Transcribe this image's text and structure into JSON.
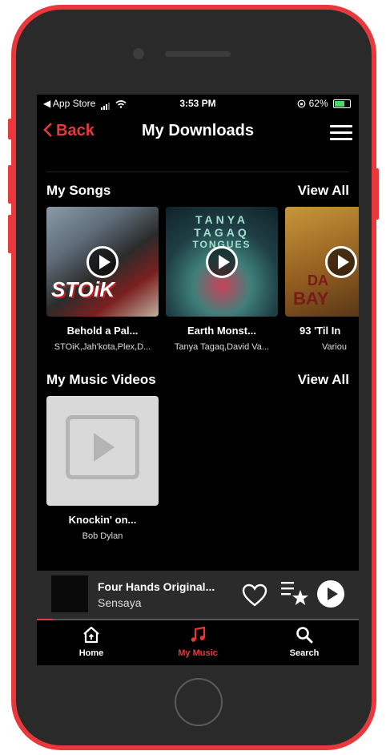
{
  "status_bar": {
    "carrier": "◀ App Store",
    "time": "3:53 PM",
    "battery": "62%"
  },
  "header": {
    "back_label": "Back",
    "title": "My Downloads"
  },
  "songs_section": {
    "title": "My Songs",
    "view_all": "View All",
    "items": [
      {
        "title": "Behold a Pal...",
        "artist": "STOiK,Jah'kota,Plex,D..."
      },
      {
        "title": "Earth Monst...",
        "artist": "Tanya Tagaq,David Va..."
      },
      {
        "title": "93 'Til In",
        "artist": "Variou"
      }
    ]
  },
  "videos_section": {
    "title": "My Music Videos",
    "view_all": "View All",
    "items": [
      {
        "title": "Knockin' on...",
        "artist": "Bob Dylan"
      }
    ]
  },
  "album_art_text": {
    "stoik": "STOiK",
    "tanya_1": "TANYA",
    "tanya_2": "TAGAQ",
    "tanya_3": "TONGUES",
    "bay_1": "DA",
    "bay_2": "BAY"
  },
  "now_playing": {
    "title": "Four Hands Original...",
    "artist": "Sensaya",
    "progress": 0.05
  },
  "tab_bar": {
    "tabs": [
      {
        "label": "Home",
        "icon": "home-icon"
      },
      {
        "label": "My Music",
        "icon": "music-note-icon",
        "active": true
      },
      {
        "label": "Search",
        "icon": "search-icon"
      }
    ]
  },
  "colors": {
    "accent": "#e8383b",
    "background": "#000000",
    "mini_player": "#2b2b2b"
  }
}
